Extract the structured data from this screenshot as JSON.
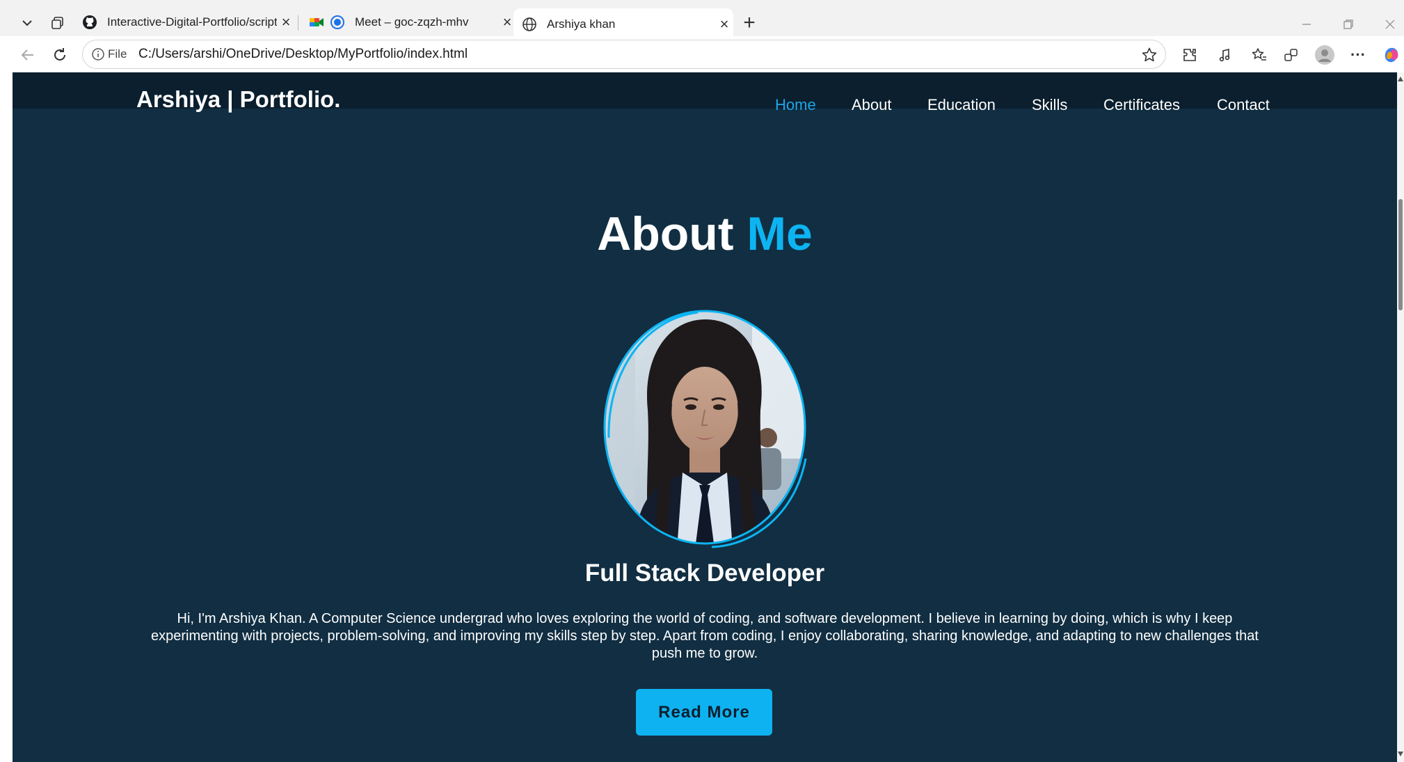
{
  "browser": {
    "tabs": [
      {
        "label": "Interactive-Digital-Portfolio/script",
        "icon": "github-icon",
        "active": false
      },
      {
        "label": "Meet – goc-zqzh-mhv",
        "icon": "google-meet-icon",
        "active": false
      },
      {
        "label": "Arshiya khan",
        "icon": "globe-icon",
        "active": true
      }
    ],
    "new_tab_symbol": "+",
    "address": {
      "scheme_label": "File",
      "url": "C:/Users/arshi/OneDrive/Desktop/MyPortfolio/index.html"
    }
  },
  "site": {
    "logo": "Arshiya | Portfolio.",
    "nav": [
      {
        "label": "Home",
        "active": true
      },
      {
        "label": "About",
        "active": false
      },
      {
        "label": "Education",
        "active": false
      },
      {
        "label": "Skills",
        "active": false
      },
      {
        "label": "Certificates",
        "active": false
      },
      {
        "label": "Contact",
        "active": false
      }
    ],
    "about": {
      "title_main": "About",
      "title_accent": "Me",
      "role": "Full Stack Developer",
      "bio": "Hi, I'm Arshiya Khan. A Computer Science undergrad who loves exploring the world of coding, and software development. I believe in learning by doing, which is why I keep experimenting with projects, problem-solving, and improving my skills step by step. Apart from coding, I enjoy collaborating, sharing knowledge, and adapting to new challenges that push me to grow.",
      "button": "Read More"
    }
  },
  "colors": {
    "page_bg": "#112e42",
    "header_bg": "#0b1f2e",
    "accent": "#0db4f2",
    "nav_active": "#1ea6e8"
  }
}
